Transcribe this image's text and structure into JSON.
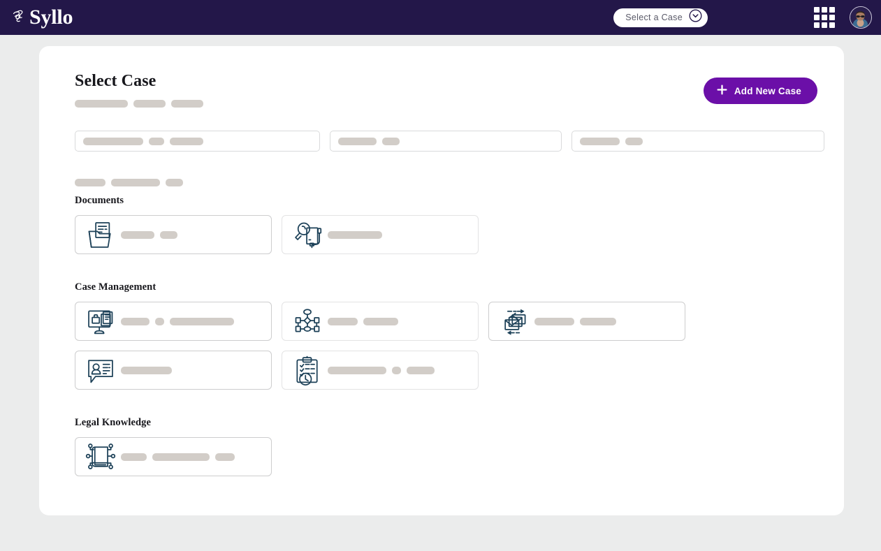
{
  "app": {
    "brand_name": "Syllo",
    "brand_mark": "syllo-logo-mark",
    "header_bg": "#231749",
    "accent": "#6b0fa8",
    "icon_ink": "#1d4158",
    "skeleton_color": "#d2cdc8",
    "page_bg": "#ebecec"
  },
  "header": {
    "case_selector": {
      "label": "Select a  Case",
      "chevron_icon": "chevron-down-circle-icon"
    },
    "apps_grid_icon": "apps-grid-icon",
    "avatar": "user-avatar"
  },
  "main": {
    "title": "Select Case",
    "add_case_button": {
      "label": "Add New Case",
      "icon": "plus-icon"
    },
    "title_skeleton": [
      76,
      46,
      46
    ],
    "filters": [
      {
        "name": "filter-one",
        "skeleton": [
          86,
          22,
          48
        ]
      },
      {
        "name": "filter-two",
        "skeleton": [
          55,
          25
        ]
      },
      {
        "name": "filter-three",
        "skeleton": [
          57,
          25
        ]
      }
    ],
    "group_skeleton": [
      44,
      70,
      25
    ],
    "sections": [
      {
        "heading": "Documents",
        "tiles": [
          {
            "name": "tile-document-folder",
            "icon": "folder-document-icon",
            "emphasis": true,
            "skeleton": [
              48,
              25
            ]
          },
          {
            "name": "tile-document-search",
            "icon": "magnifier-document-icon",
            "emphasis": false,
            "skeleton": [
              78
            ]
          }
        ]
      },
      {
        "heading": "Case Management",
        "tiles": [
          {
            "name": "tile-case-workspace",
            "icon": "monitor-briefcase-document-icon",
            "emphasis": true,
            "skeleton": [
              41,
              13,
              92
            ]
          },
          {
            "name": "tile-case-workflow",
            "icon": "workflow-chart-icon",
            "emphasis": false,
            "skeleton": [
              43,
              50
            ]
          },
          {
            "name": "tile-case-correspondence",
            "icon": "stacked-envelopes-arrows-icon",
            "emphasis": true,
            "skeleton": [
              57,
              52
            ]
          },
          {
            "name": "tile-case-contacts",
            "icon": "person-speech-bubble-icon",
            "emphasis": true,
            "skeleton": [
              73
            ]
          },
          {
            "name": "tile-case-tasks",
            "icon": "clipboard-checklist-clock-icon",
            "emphasis": false,
            "skeleton": [
              84,
              13,
              40
            ]
          }
        ]
      },
      {
        "heading": "Legal Knowledge",
        "tiles": [
          {
            "name": "tile-legal-knowledge-base",
            "icon": "book-network-icon",
            "emphasis": true,
            "skeleton": [
              37,
              82,
              28
            ]
          }
        ]
      }
    ]
  }
}
